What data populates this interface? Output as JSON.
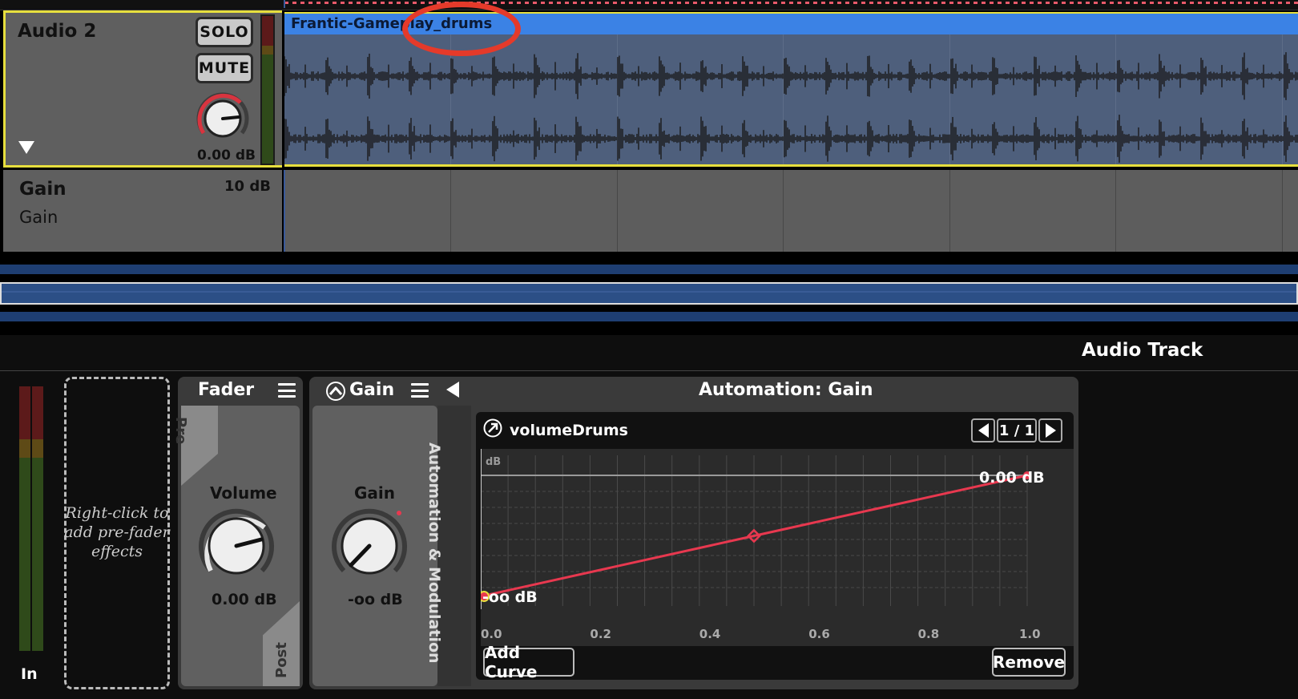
{
  "track": {
    "name": "Audio 2",
    "solo_label": "SOLO",
    "mute_label": "MUTE",
    "volume": "0.00 dB"
  },
  "clip": {
    "name": "Frantic-Gameplay_drums"
  },
  "gain_lane": {
    "title": "Gain",
    "subtitle": "Gain",
    "value": "10 dB"
  },
  "panel": {
    "title": "Audio Track",
    "in_label": "In",
    "prefader_hint": "Right-click to add pre-fader effects"
  },
  "fader_plugin": {
    "title": "Fader",
    "pre_label": "Pre",
    "post_label": "Post",
    "volume_label": "Volume",
    "volume_value": "0.00 dB"
  },
  "gain_plugin": {
    "title": "Gain",
    "knob_label": "Gain",
    "knob_value": "-oo dB"
  },
  "automation": {
    "title": "Automation: Gain",
    "side_label": "Automation & Modulation",
    "curve_name": "volumeDrums",
    "page": "1 / 1",
    "add_curve_label": "Add Curve",
    "remove_label": "Remove",
    "y_unit": "dB",
    "start_label": "-oo dB",
    "end_label": "0.00 dB"
  },
  "chart_data": {
    "type": "line",
    "x_ticks": [
      "0.0",
      "0.2",
      "0.4",
      "0.6",
      "0.8",
      "1.0"
    ],
    "xlim": [
      0,
      1
    ],
    "grid": true,
    "series": [
      {
        "points": [
          [
            0.0,
            0.0
          ],
          [
            0.5,
            0.5
          ],
          [
            1.0,
            1.0
          ]
        ],
        "color": "#e8384f"
      }
    ]
  },
  "colors": {
    "accent_yellow": "#e7df3e",
    "clip_blue": "#3b82e5",
    "curve_red": "#e8384f",
    "annotation_red": "#e53a2a"
  },
  "icons": {
    "pan_knob": "knob-icon",
    "curve_icon": "arrow-up-right-icon",
    "gain_plugin_icon": "automation-icon"
  }
}
